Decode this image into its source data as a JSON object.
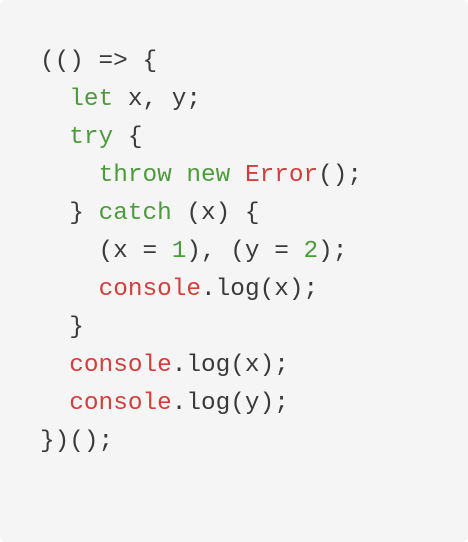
{
  "colors": {
    "background": "#f5f5f5",
    "plain": "#3a3a3a",
    "keyword": "#4f9a3e",
    "builtin": "#d0403e",
    "number": "#4f9a3e"
  },
  "code": {
    "language": "javascript",
    "lines": [
      [
        {
          "t": "(() => {",
          "k": "plain"
        }
      ],
      [
        {
          "t": "  ",
          "k": "plain"
        },
        {
          "t": "let",
          "k": "keyword"
        },
        {
          "t": " x, y;",
          "k": "plain"
        }
      ],
      [
        {
          "t": "  ",
          "k": "plain"
        },
        {
          "t": "try",
          "k": "keyword"
        },
        {
          "t": " {",
          "k": "plain"
        }
      ],
      [
        {
          "t": "    ",
          "k": "plain"
        },
        {
          "t": "throw",
          "k": "keyword"
        },
        {
          "t": " ",
          "k": "plain"
        },
        {
          "t": "new",
          "k": "keyword"
        },
        {
          "t": " ",
          "k": "plain"
        },
        {
          "t": "Error",
          "k": "builtin"
        },
        {
          "t": "();",
          "k": "plain"
        }
      ],
      [
        {
          "t": "  } ",
          "k": "plain"
        },
        {
          "t": "catch",
          "k": "keyword"
        },
        {
          "t": " (x) {",
          "k": "plain"
        }
      ],
      [
        {
          "t": "    (x = ",
          "k": "plain"
        },
        {
          "t": "1",
          "k": "number"
        },
        {
          "t": "), (y = ",
          "k": "plain"
        },
        {
          "t": "2",
          "k": "number"
        },
        {
          "t": ");",
          "k": "plain"
        }
      ],
      [
        {
          "t": "    ",
          "k": "plain"
        },
        {
          "t": "console",
          "k": "builtin"
        },
        {
          "t": ".log(x);",
          "k": "plain"
        }
      ],
      [
        {
          "t": "  }",
          "k": "plain"
        }
      ],
      [
        {
          "t": "  ",
          "k": "plain"
        },
        {
          "t": "console",
          "k": "builtin"
        },
        {
          "t": ".log(x);",
          "k": "plain"
        }
      ],
      [
        {
          "t": "  ",
          "k": "plain"
        },
        {
          "t": "console",
          "k": "builtin"
        },
        {
          "t": ".log(y);",
          "k": "plain"
        }
      ],
      [
        {
          "t": "})();",
          "k": "plain"
        }
      ]
    ]
  }
}
